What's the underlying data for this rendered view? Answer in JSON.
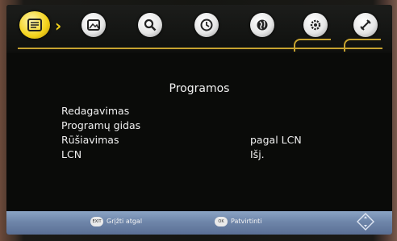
{
  "topbar": {
    "tabs": [
      {
        "name": "programs-icon",
        "active": true
      },
      {
        "name": "image-icon",
        "active": false
      },
      {
        "name": "search-icon",
        "active": false
      },
      {
        "name": "clock-icon",
        "active": false
      },
      {
        "name": "globe-icon",
        "active": false
      },
      {
        "name": "gear-icon",
        "active": false
      },
      {
        "name": "satellite-icon",
        "active": false
      }
    ],
    "accent_color": "#c7a330",
    "active_color": "#f3d21a"
  },
  "menu": {
    "title": "Programos",
    "items": [
      {
        "label": "Redagavimas",
        "value": ""
      },
      {
        "label": "Programų gidas",
        "value": ""
      },
      {
        "label": "Rūšiavimas",
        "value": "pagal LCN"
      },
      {
        "label": "LCN",
        "value": "Išj."
      }
    ]
  },
  "bottombar": {
    "exit_key": "EXIT",
    "back_label": "Grįžti atgal",
    "ok_key": "OK",
    "confirm_label": "Patvirtinti"
  }
}
